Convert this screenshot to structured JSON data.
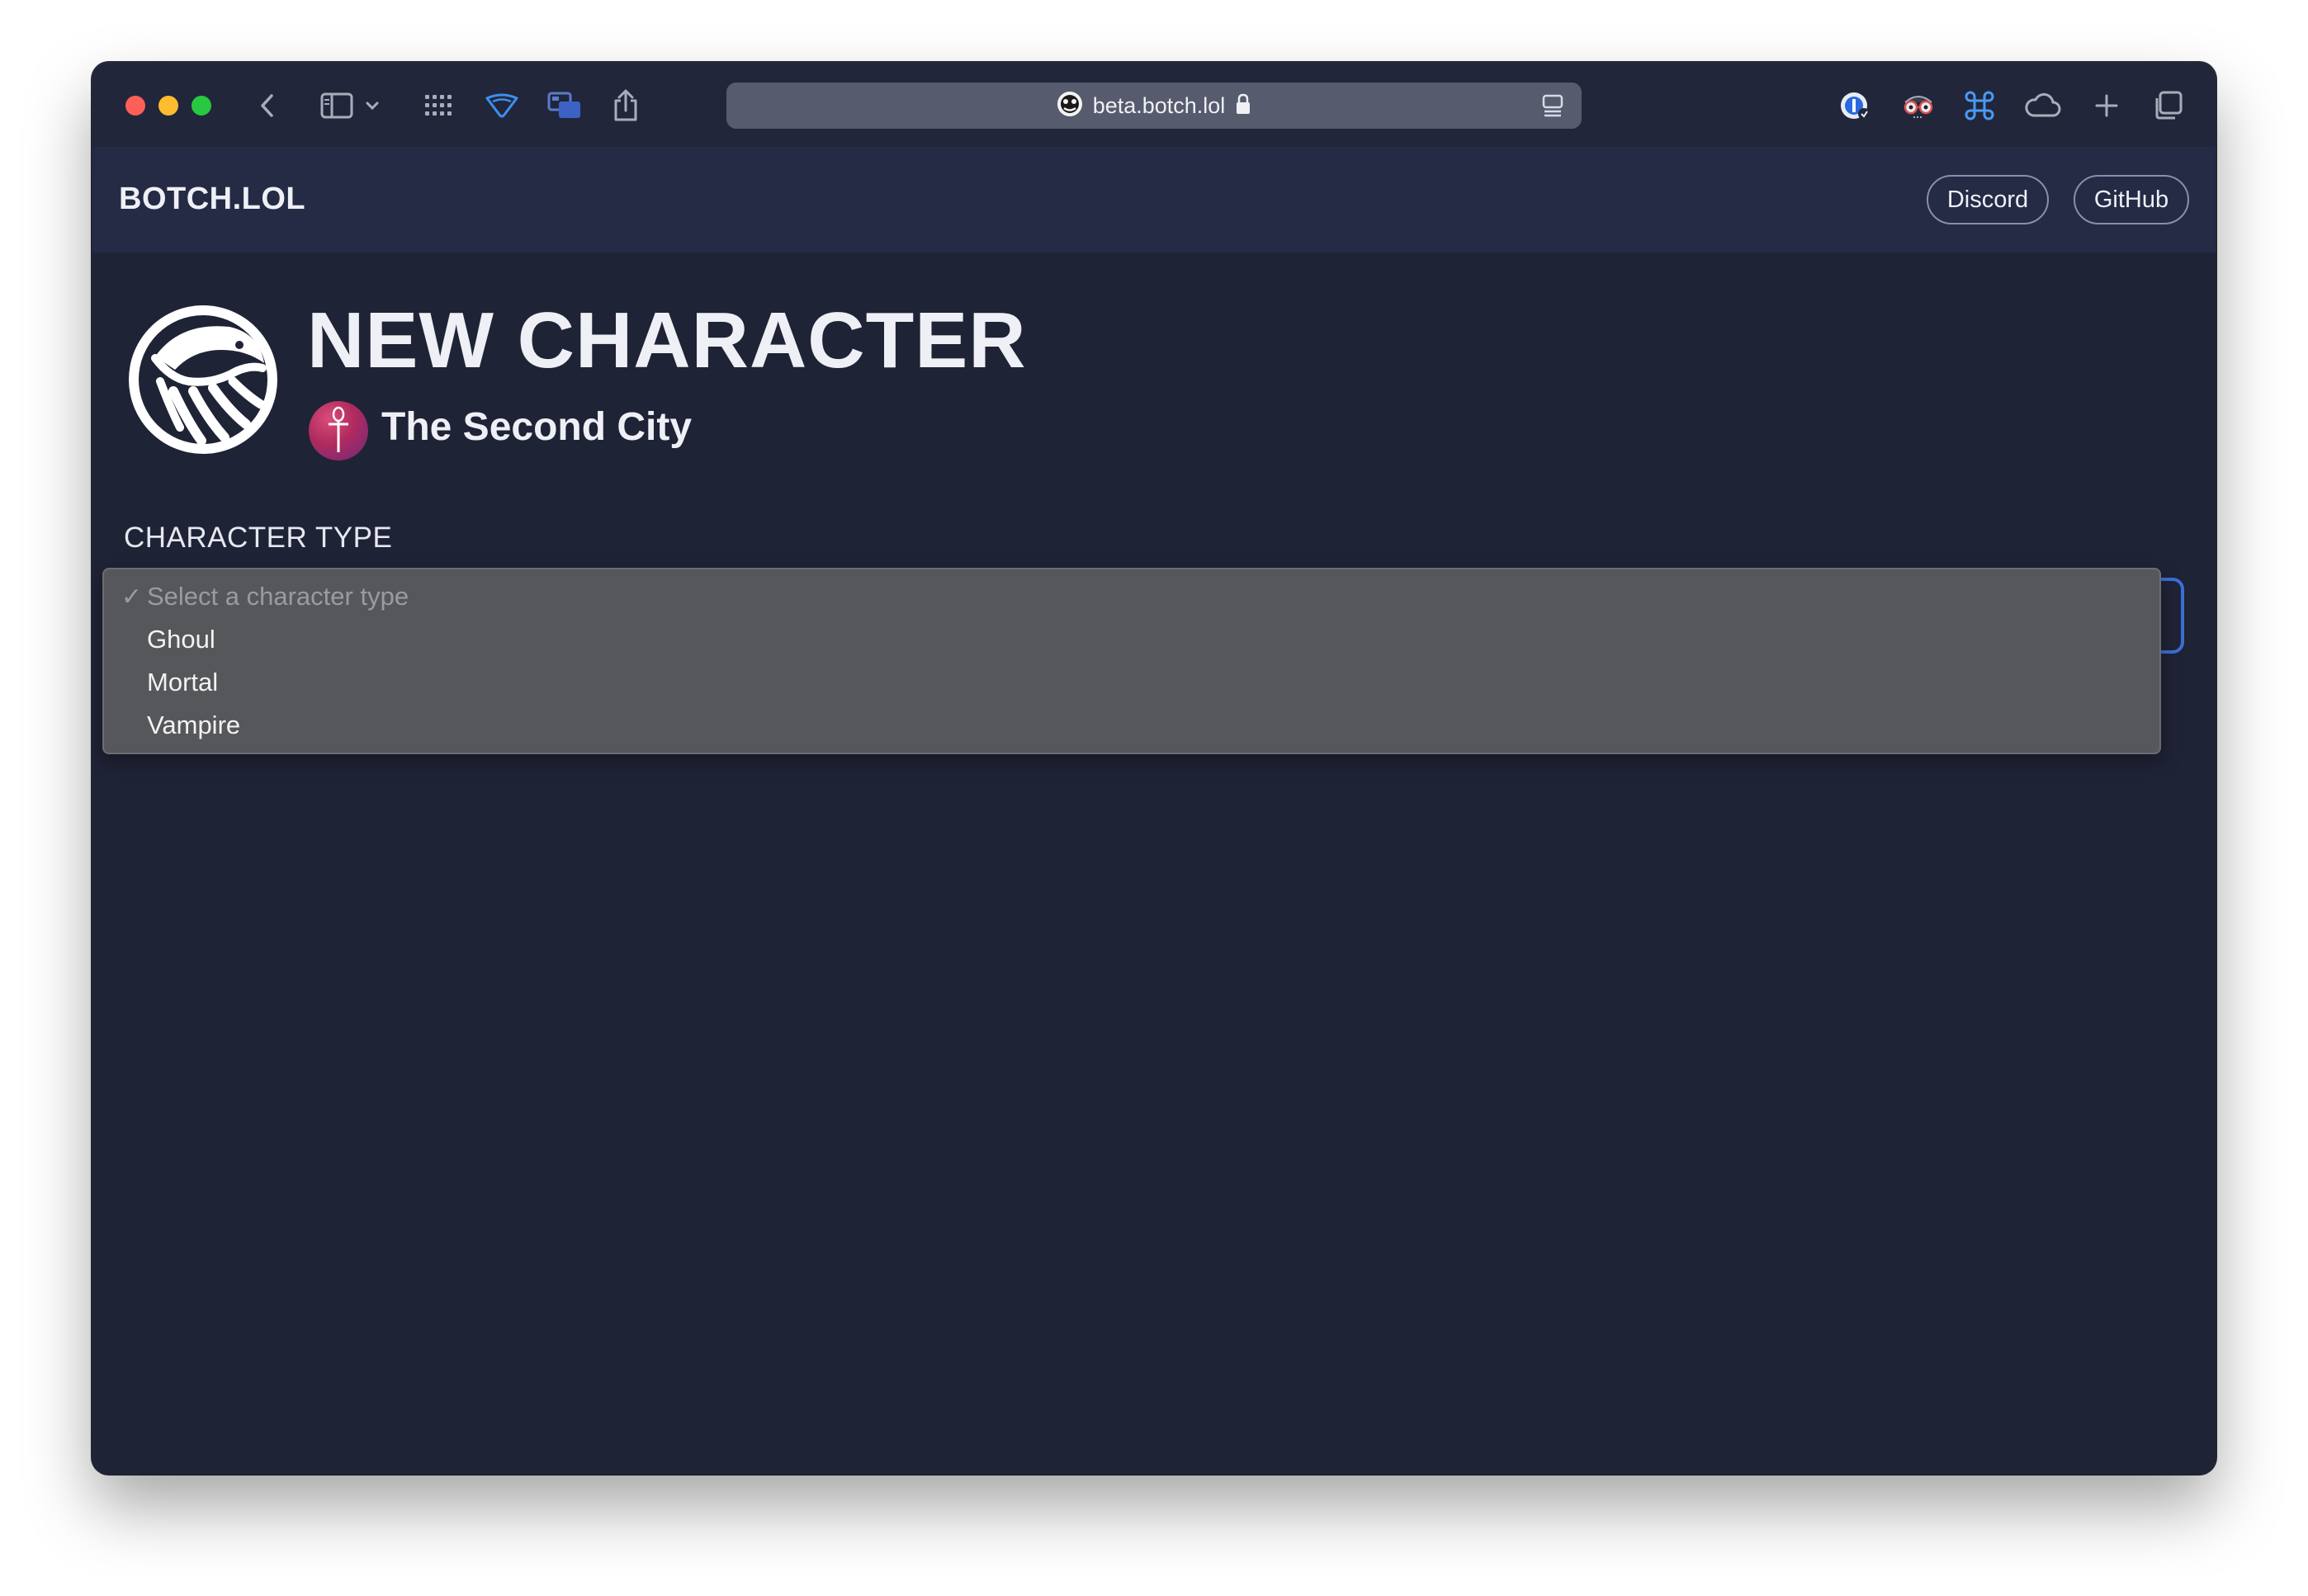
{
  "browser": {
    "url": "beta.botch.lol",
    "colors": {
      "close": "#fe5f57",
      "minimize": "#febc2e",
      "zoom": "#28c840",
      "accent_blue": "#3c8ff0"
    },
    "toolbar_icons": [
      "back-icon",
      "sidebar-icon",
      "chevron-down-icon",
      "tab-overview-icon",
      "wifi-shield-icon",
      "window-icon",
      "share-icon"
    ],
    "extension_icons": [
      "onepassword-icon",
      "glasses-extension-icon",
      "command-icon",
      "cloud-icon",
      "new-tab-icon",
      "tabs-overview-icon"
    ]
  },
  "header": {
    "brand": "BOTCH.LOL",
    "links": [
      {
        "label": "Discord"
      },
      {
        "label": "GitHub"
      }
    ]
  },
  "page": {
    "title": "NEW CHARACTER",
    "chronicle": "The Second City",
    "field_label": "CHARACTER TYPE",
    "select": {
      "check_mark": "✓",
      "options": [
        {
          "label": "Select a character type",
          "selected": true,
          "disabled": true
        },
        {
          "label": "Ghoul"
        },
        {
          "label": "Mortal"
        },
        {
          "label": "Vampire"
        }
      ]
    }
  }
}
